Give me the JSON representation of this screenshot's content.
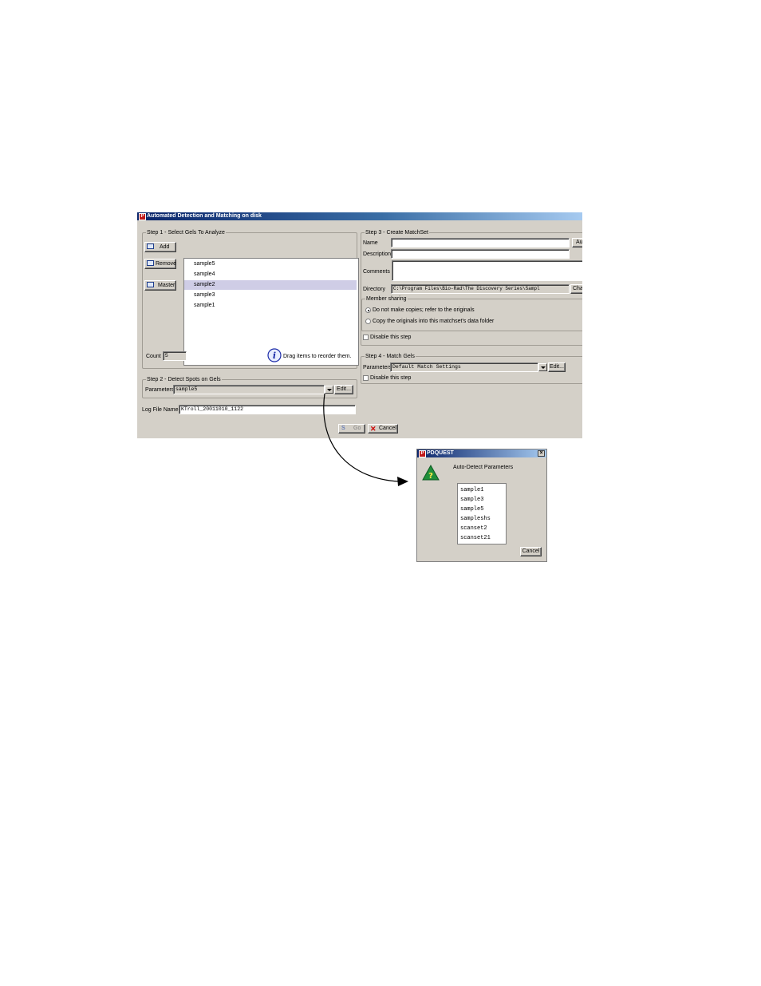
{
  "main_window": {
    "title": "Automated Detection and Matching on disk",
    "app_logo": "P"
  },
  "step1": {
    "legend": "Step 1 - Select Gels To Analyze",
    "add_label": "Add",
    "remove_label": "Remove",
    "master_label": "Master",
    "gels": [
      "sample5",
      "sample4",
      "sample2",
      "sample3",
      "sample1"
    ],
    "selected_gel": "sample2",
    "count_label": "Count",
    "count_value": "5",
    "hint": "Drag items to reorder them.",
    "info_icon": "i"
  },
  "step2": {
    "legend": "Step 2 - Detect Spots on Gels",
    "parameters_label": "Parameters",
    "parameters_value": "sample5",
    "edit_label": "Edit..."
  },
  "log": {
    "label": "Log File Name",
    "value": "KTroll_20011010_1122"
  },
  "actions": {
    "go_label": "Go",
    "cancel_label": "Cancel"
  },
  "step3": {
    "legend": "Step 3 - Create MatchSet",
    "name_label": "Name",
    "name_value": "",
    "auto_label": "Au",
    "description_label": "Description",
    "description_value": "",
    "comments_label": "Comments",
    "comments_value": "",
    "directory_label": "Directory",
    "directory_value": "C:\\Program Files\\Bio-Rad\\The Discovery Series\\Sampl",
    "change_label": "Cha",
    "member_sharing": {
      "legend": "Member sharing",
      "option1": "Do not make copies; refer to the originals",
      "option2": "Copy the originals into this matchset's data folder"
    },
    "disable_label": "Disable this step"
  },
  "step4": {
    "legend": "Step 4 - Match Gels",
    "parameters_label": "Parameters",
    "parameters_value": "Default Match Settings",
    "edit_label": "Edit...",
    "disable_label": "Disable this step"
  },
  "popup": {
    "title": "PDQUEST",
    "close_glyph": "×",
    "prompt": "Auto-Detect Parameters",
    "question_glyph": "?",
    "options": [
      "sample1",
      "sample3",
      "sample5",
      "sampleshs",
      "scanset2",
      "scanset21"
    ],
    "cancel_label": "Cancel"
  },
  "colors": {
    "window_bg": "#d4d0c8",
    "title_start": "#0a246a",
    "title_end": "#a6caf0",
    "selection": "#cfcde6",
    "warning_triangle": "#1f8f3a",
    "info_circle": "#1c2ca8",
    "cancel_x": "#cc0000"
  },
  "icons": [
    "info-icon",
    "question-warning-icon",
    "close-icon",
    "dropdown-arrow-icon",
    "arrow-connector"
  ]
}
